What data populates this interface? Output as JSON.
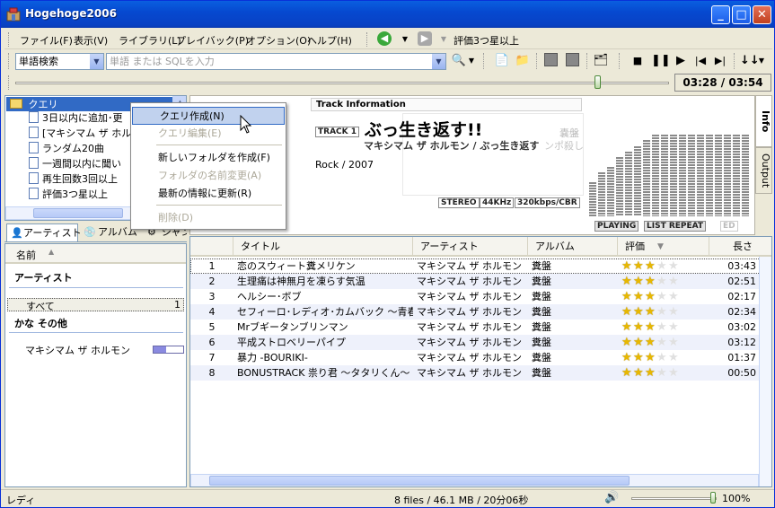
{
  "window": {
    "title": "Hogehoge2006"
  },
  "menu": [
    "ファイル(F)",
    "表示(V)",
    "ライブラリ(L)",
    "プレイバック(P)",
    "オプション(O)",
    "ヘルプ(H)"
  ],
  "nav": {
    "current_query": "評価3つ星以上"
  },
  "search": {
    "mode": "単語検索",
    "placeholder": "単語 または SQLを入力"
  },
  "player": {
    "time": "03:28 / 03:54",
    "seek_fraction": 0.89
  },
  "query_tree": {
    "root": "クエリ",
    "items": [
      "3日以内に追加･更",
      "[マキシマム ザ ホル",
      "ランダム20曲",
      "一週間以内に聞い",
      "再生回数3回以上",
      "評価3つ星以上"
    ]
  },
  "context_menu": {
    "items": [
      {
        "label": "クエリ作成(N)",
        "enabled": true,
        "selected": true
      },
      {
        "label": "クエリ編集(E)",
        "enabled": false
      },
      {
        "label": "新しいフォルダを作成(F)",
        "enabled": true
      },
      {
        "label": "フォルダの名前変更(A)",
        "enabled": false
      },
      {
        "label": "最新の情報に更新(R)",
        "enabled": true
      },
      {
        "label": "削除(D)",
        "enabled": false
      }
    ]
  },
  "info": {
    "heading": "Track Information",
    "track_badge": "TRACK 1",
    "title": "ぶっ生き返す!!",
    "artist_album": "マキシマム ザ ホルモン / ぶっ生き返す",
    "genre_year": "Rock / 2007",
    "ghost_album": "嚢盤",
    "ghost_text": "ンポ殺し",
    "tech": [
      "STEREO",
      "44KHz",
      "320kbps/CBR"
    ],
    "status": [
      "PLAYING",
      "LIST REPEAT",
      "ED"
    ]
  },
  "side_tabs": [
    "Info",
    "Output"
  ],
  "left_tabs": [
    "アーティスト",
    "アルバム",
    "ジャン"
  ],
  "artist_pane": {
    "header": "名前",
    "group1": "アーティスト",
    "all": "すべて",
    "all_count": "1",
    "group2": "かな その他",
    "artist": "マキシマム ザ ホルモン"
  },
  "track_columns": [
    "タイトル",
    "アーティスト",
    "アルバム",
    "評価",
    "長さ"
  ],
  "tracks": [
    {
      "no": "1",
      "title": "恋のスウィート糞メリケン",
      "artist": "マキシマム ザ ホルモン",
      "album": "糞盤",
      "rating": 3,
      "length": "03:43"
    },
    {
      "no": "2",
      "title": "生理痛は神無月を凍らす気温",
      "artist": "マキシマム ザ ホルモン",
      "album": "糞盤",
      "rating": 3,
      "length": "02:51"
    },
    {
      "no": "3",
      "title": "ヘルシー･ボブ",
      "artist": "マキシマム ザ ホルモン",
      "album": "糞盤",
      "rating": 3,
      "length": "02:17"
    },
    {
      "no": "4",
      "title": "セフィーロ･レディオ･カムバック ～青春最...",
      "artist": "マキシマム ザ ホルモン",
      "album": "糞盤",
      "rating": 3,
      "length": "02:34"
    },
    {
      "no": "5",
      "title": "Mrブギータンブリンマン",
      "artist": "マキシマム ザ ホルモン",
      "album": "糞盤",
      "rating": 3,
      "length": "03:02"
    },
    {
      "no": "6",
      "title": "平成ストロベリーパイプ",
      "artist": "マキシマム ザ ホルモン",
      "album": "糞盤",
      "rating": 3,
      "length": "03:12"
    },
    {
      "no": "7",
      "title": "暴力 -BOURIKI-",
      "artist": "マキシマム ザ ホルモン",
      "album": "糞盤",
      "rating": 3,
      "length": "01:37"
    },
    {
      "no": "8",
      "title": "BONUSTRACK 祟り君 ～タタリくん～",
      "artist": "マキシマム ザ ホルモン",
      "album": "糞盤",
      "rating": 3,
      "length": "00:50"
    }
  ],
  "status": {
    "left": "レディ",
    "center": "8 files / 46.1 MB / 20分06秒",
    "volume": "100%"
  }
}
